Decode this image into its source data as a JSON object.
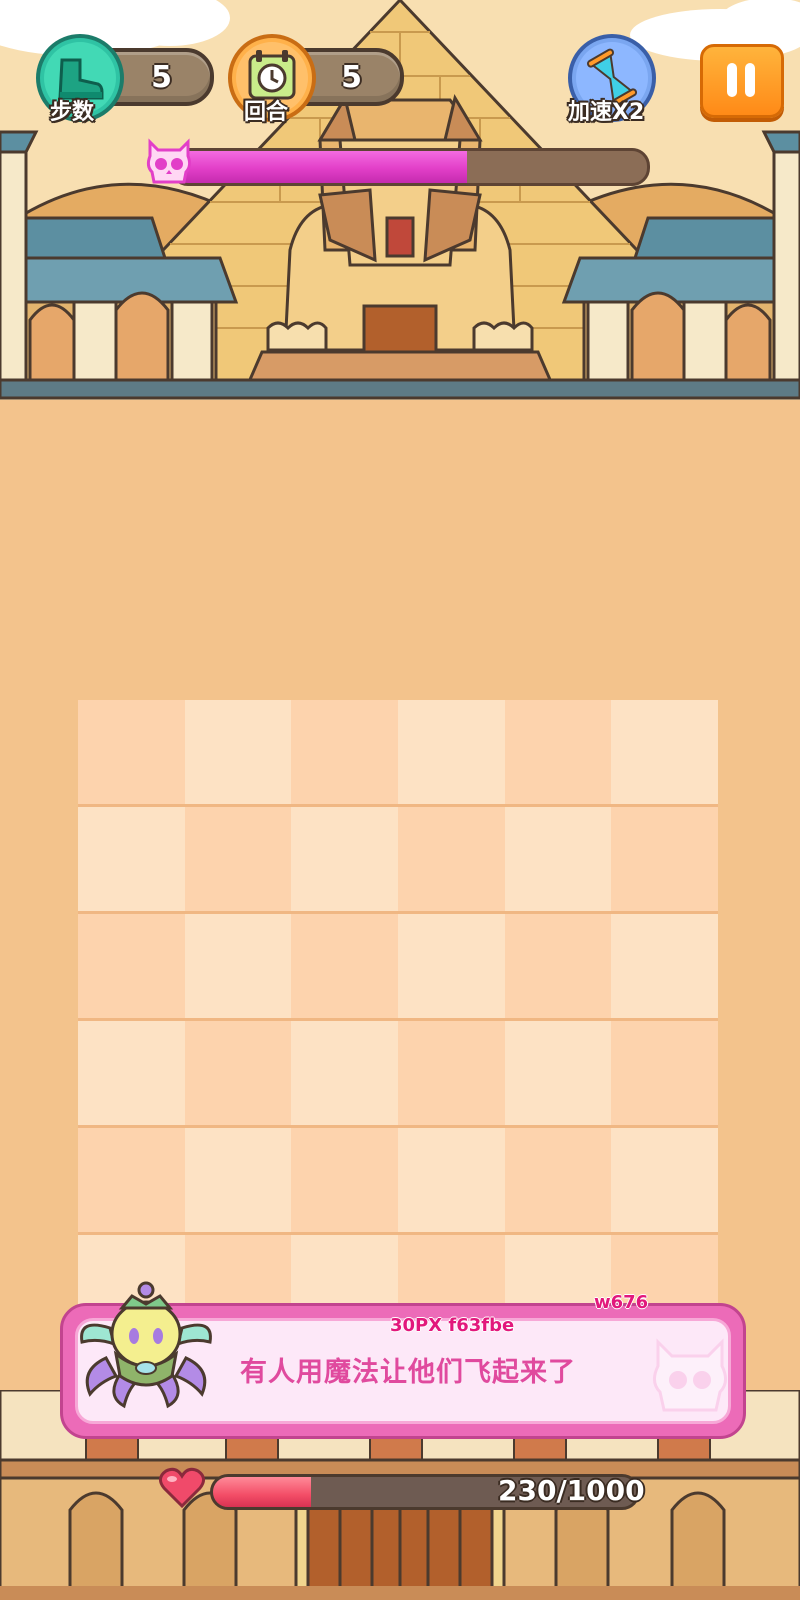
{
  "hud": {
    "steps": {
      "label": "步数",
      "value": "5",
      "icon": "boot-icon"
    },
    "rounds": {
      "label": "回合",
      "value": "5",
      "icon": "clock-icon"
    },
    "speed": {
      "label": "加速X2",
      "icon": "hourglass-icon"
    },
    "pause": {
      "icon": "pause-icon"
    }
  },
  "boss": {
    "progress": 0.62,
    "icon": "skull-icon"
  },
  "board": {
    "rows": 6,
    "cols": 6,
    "light": "#fde2c4",
    "dark": "#fdd3ad"
  },
  "dialog": {
    "name": "30PX f63fbe",
    "tag": "w676",
    "message": "有人用魔法让他们飞起来了",
    "avatar": "monster-avatar"
  },
  "hp": {
    "current": 230,
    "max": 1000,
    "text": "230/1000",
    "icon": "heart-icon"
  },
  "colors": {
    "accent_pink": "#e23fc8",
    "hp_red": "#f34d67",
    "pause_orange": "#ff8a17",
    "background_sand": "#f3c38c"
  }
}
